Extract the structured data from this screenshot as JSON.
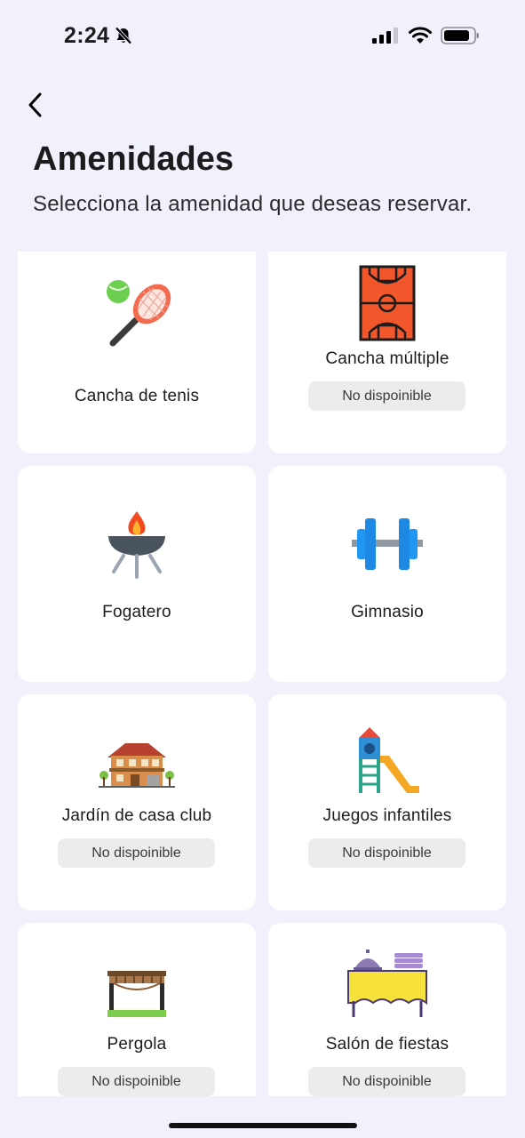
{
  "status": {
    "time": "2:24"
  },
  "header": {
    "title": "Amenidades",
    "subtitle": "Selecciona la amenidad que deseas reservar."
  },
  "amenities": [
    {
      "label": "Cancha de tenis",
      "badge": "",
      "icon": "tennis-racket-icon"
    },
    {
      "label": "Cancha múltiple",
      "badge": "No dispoinible",
      "icon": "basketball-court-icon"
    },
    {
      "label": "Fogatero",
      "badge": "",
      "icon": "grill-icon"
    },
    {
      "label": "Gimnasio",
      "badge": "",
      "icon": "dumbbell-icon"
    },
    {
      "label": "Jardín de casa club",
      "badge": "No dispoinible",
      "icon": "clubhouse-icon"
    },
    {
      "label": "Juegos infantiles",
      "badge": "No dispoinible",
      "icon": "playground-slide-icon"
    },
    {
      "label": "Pergola",
      "badge": "No dispoinible",
      "icon": "pergola-icon"
    },
    {
      "label": "Salón de fiestas",
      "badge": "No dispoinible",
      "icon": "party-hall-icon"
    }
  ],
  "colors": {
    "background": "#f1f1fb",
    "card": "#ffffff",
    "badge": "#ececec"
  }
}
